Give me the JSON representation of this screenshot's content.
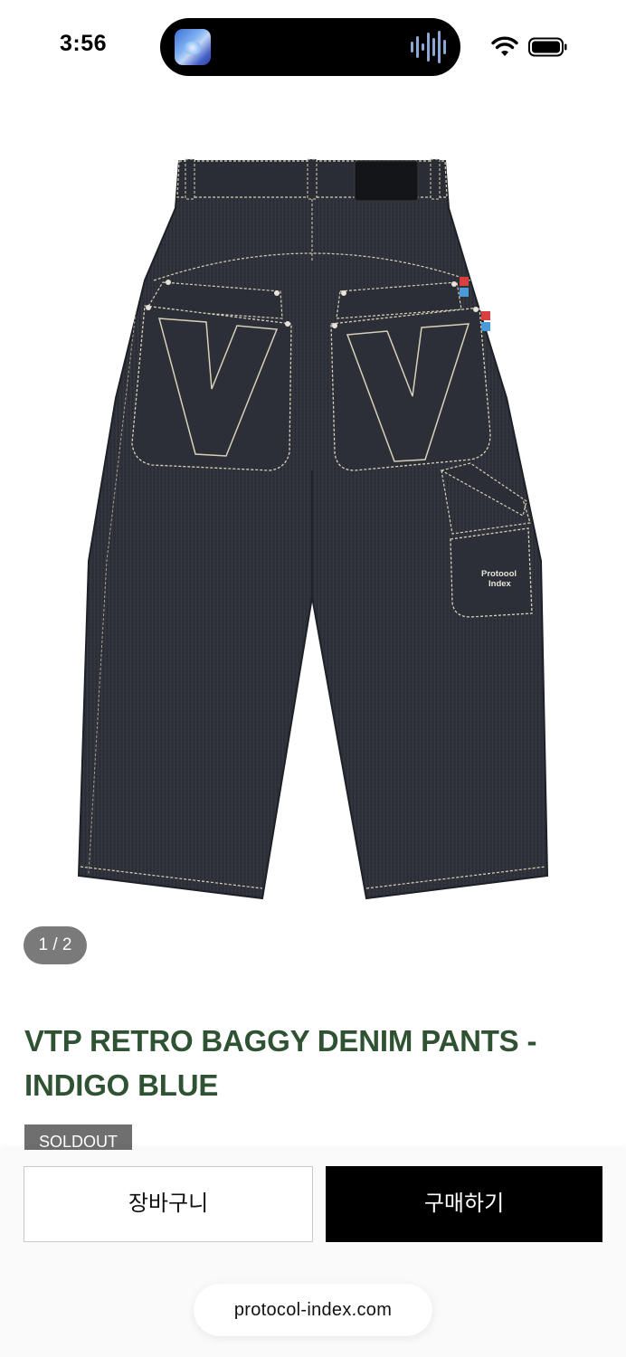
{
  "status_bar": {
    "time": "3:56"
  },
  "gallery": {
    "counter": "1 / 2",
    "image": {
      "patch_text": "Protoool Index",
      "colors": {
        "denim": "#2d3038",
        "stitch": "#d8d0b8"
      }
    }
  },
  "product": {
    "title": "VTP RETRO BAGGY DENIM PANTS - INDIGO BLUE",
    "badge": "SOLDOUT"
  },
  "actions": {
    "cart_label": "장바구니",
    "buy_label": "구매하기"
  },
  "browser": {
    "url": "protocol-index.com"
  },
  "colors": {
    "title": "#2f5233",
    "badge_bg": "#6f6f6f",
    "buy_bg": "#000000"
  }
}
